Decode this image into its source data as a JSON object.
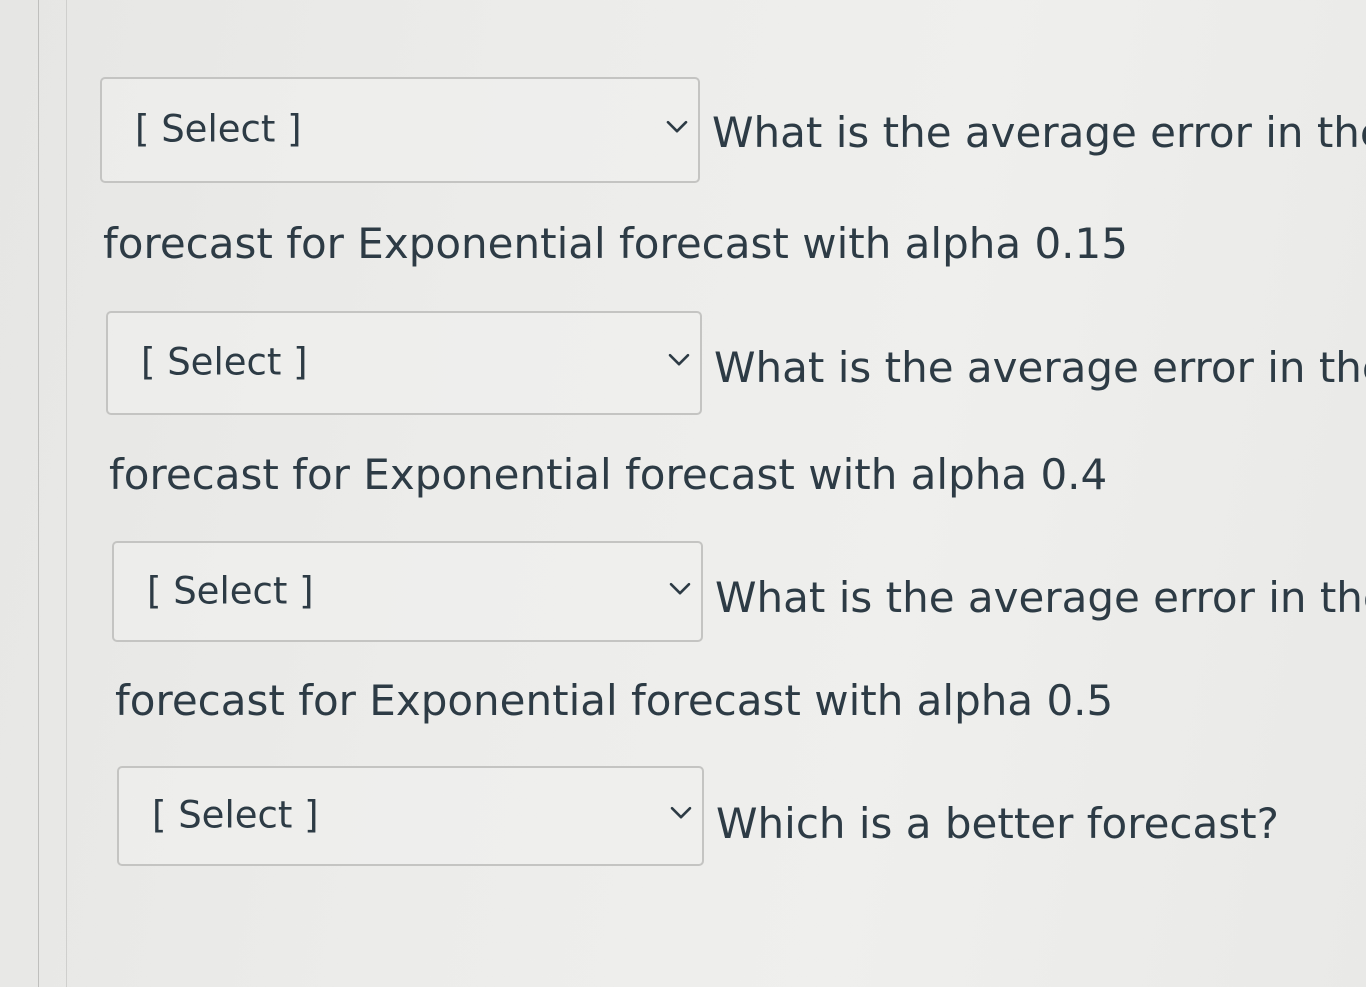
{
  "questions": [
    {
      "select_value": "[ Select ]",
      "prompt": "What is the average error in the",
      "continuation": "forecast for Exponential forecast with alpha 0.15"
    },
    {
      "select_value": "[ Select ]",
      "prompt": "What is the average error in the",
      "continuation": "forecast for Exponential forecast with alpha 0.4"
    },
    {
      "select_value": "[ Select ]",
      "prompt": "What is the average error in the",
      "continuation": "forecast for Exponential forecast with alpha 0.5"
    },
    {
      "select_value": "[ Select ]",
      "prompt": "Which is a better forecast?"
    }
  ],
  "icons": {
    "dropdown_chevron": "chevron-down-icon"
  }
}
